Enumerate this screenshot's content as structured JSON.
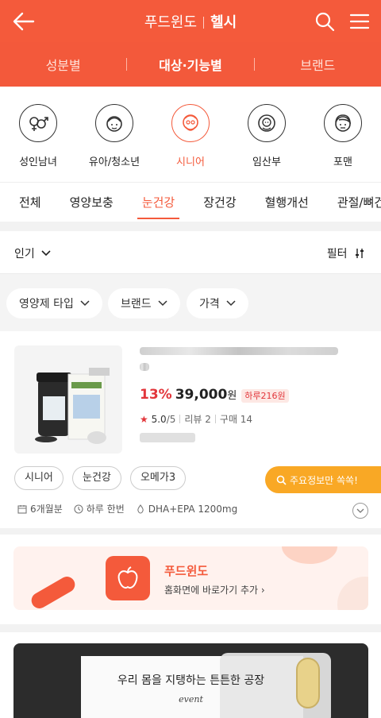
{
  "header": {
    "brand": "푸드윈도",
    "section": "헬시",
    "back_icon": "back-arrow-icon",
    "search_icon": "search-icon",
    "menu_icon": "hamburger-menu-icon"
  },
  "subnav": {
    "items": [
      "성분별",
      "대상·기능별",
      "브랜드"
    ],
    "active": "대상·기능별"
  },
  "categories": [
    {
      "label": "성인남녀",
      "icon": "gender-icon"
    },
    {
      "label": "유아/청소년",
      "icon": "child-face-icon"
    },
    {
      "label": "시니어",
      "icon": "senior-face-icon",
      "active": true
    },
    {
      "label": "임산부",
      "icon": "baby-icon"
    },
    {
      "label": "포맨",
      "icon": "man-face-icon"
    }
  ],
  "tabs": [
    "전체",
    "영양보충",
    "눈건강",
    "장건강",
    "혈행개선",
    "관절/뼈건"
  ],
  "active_tab": "눈건강",
  "sort": {
    "label": "인기",
    "filter_label": "필터"
  },
  "chips": [
    "영양제 타입",
    "브랜드",
    "가격"
  ],
  "product": {
    "discount": "13%",
    "price": "39,000",
    "unit": "원",
    "per_day": "하루216원",
    "rating": "5.0",
    "rating_max": "/5",
    "reviews": "리뷰 2",
    "purchases": "구매 14",
    "tags": [
      "시니어",
      "눈건강",
      "오메가3"
    ],
    "key_info_button": "주요정보만 쏙쏙!",
    "meta": [
      "6개월분",
      "하루 한번",
      "DHA+EPA 1200mg"
    ]
  },
  "banner": {
    "title": "푸드윈도",
    "subtitle": "홈화면에 바로가기 추가 ›"
  },
  "event": {
    "text": "우리 몸을 지탱하는 튼튼한 공장",
    "badge": "event"
  },
  "colors": {
    "accent": "#f45a3b",
    "price_red": "#e2363b",
    "key_info": "#f9a825"
  }
}
